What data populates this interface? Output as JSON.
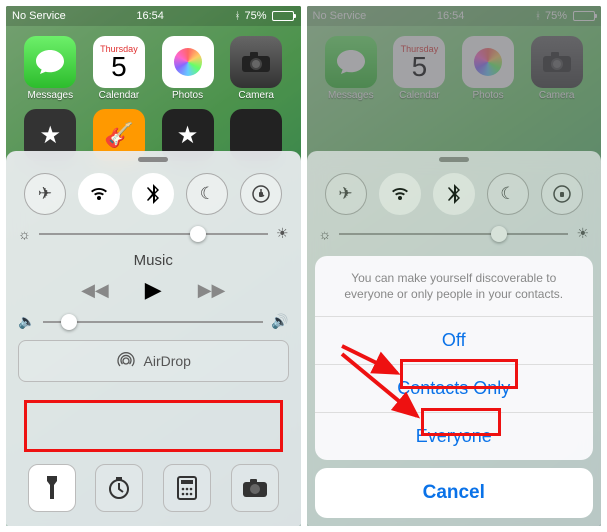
{
  "status": {
    "carrier": "No Service",
    "time": "16:54",
    "battery_pct": "75%",
    "battery_fill": "75%"
  },
  "calendar": {
    "dow": "Thursday",
    "day": "5"
  },
  "apps": {
    "messages": "Messages",
    "calendar": "Calendar",
    "photos": "Photos",
    "camera": "Camera"
  },
  "cc": {
    "toggles": {
      "airplane": "airplane",
      "wifi": "wifi",
      "bluetooth": "bluetooth",
      "dnd": "dnd",
      "rotation": "rotation-lock"
    },
    "music_label": "Music",
    "airdrop_label": "AirDrop",
    "brightness_value": 0.66,
    "volume_value": 0.08
  },
  "sheet": {
    "message": "You can make yourself discoverable to everyone or only people in your contacts.",
    "off": "Off",
    "contacts": "Contacts Only",
    "everyone": "Everyone",
    "cancel": "Cancel"
  }
}
